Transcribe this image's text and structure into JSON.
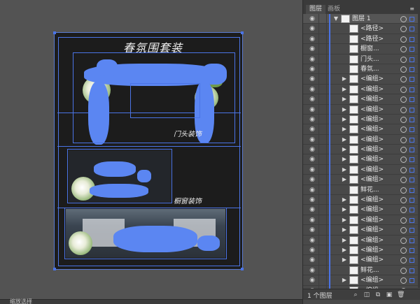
{
  "artboard": {
    "title": "春氛围套装",
    "labels": [
      "门头装饰",
      "橱窗装饰"
    ]
  },
  "status": {
    "text": "缩放选择"
  },
  "panel": {
    "tabs": [
      "图层",
      "画板"
    ],
    "menu_glyph": "≡",
    "layer_count": "1 个图层",
    "rows": [
      {
        "name": "图层 1",
        "type": "layer",
        "expand": "▼",
        "thumb": true
      },
      {
        "name": "<路径>",
        "type": "item",
        "expand": "",
        "thumb": true
      },
      {
        "name": "<路径>",
        "type": "item",
        "expand": "",
        "thumb": true
      },
      {
        "name": "橱窗...",
        "type": "item",
        "expand": "",
        "thumb": true
      },
      {
        "name": "门头...",
        "type": "item",
        "expand": "",
        "thumb": true
      },
      {
        "name": "春氛...",
        "type": "item",
        "expand": "",
        "thumb": true
      },
      {
        "name": "<编组>",
        "type": "item",
        "expand": "▶",
        "thumb": true
      },
      {
        "name": "<编组>",
        "type": "item",
        "expand": "▶",
        "thumb": true
      },
      {
        "name": "<编组>",
        "type": "item",
        "expand": "▶",
        "thumb": true
      },
      {
        "name": "<编组>",
        "type": "item",
        "expand": "▶",
        "thumb": true
      },
      {
        "name": "<编组>",
        "type": "item",
        "expand": "▶",
        "thumb": true
      },
      {
        "name": "<编组>",
        "type": "item",
        "expand": "▶",
        "thumb": true
      },
      {
        "name": "<编组>",
        "type": "item",
        "expand": "▶",
        "thumb": true
      },
      {
        "name": "<编组>",
        "type": "item",
        "expand": "▶",
        "thumb": true
      },
      {
        "name": "<编组>",
        "type": "item",
        "expand": "▶",
        "thumb": true
      },
      {
        "name": "<编组>",
        "type": "item",
        "expand": "▶",
        "thumb": true
      },
      {
        "name": "<编组>",
        "type": "item",
        "expand": "▶",
        "thumb": true
      },
      {
        "name": "鲜花...",
        "type": "item",
        "expand": "",
        "thumb": true
      },
      {
        "name": "<编组>",
        "type": "item",
        "expand": "▶",
        "thumb": true
      },
      {
        "name": "<编组>",
        "type": "item",
        "expand": "▶",
        "thumb": true
      },
      {
        "name": "<编组>",
        "type": "item",
        "expand": "▶",
        "thumb": true
      },
      {
        "name": "<编组>",
        "type": "item",
        "expand": "▶",
        "thumb": true
      },
      {
        "name": "<编组>",
        "type": "item",
        "expand": "▶",
        "thumb": true
      },
      {
        "name": "<编组>",
        "type": "item",
        "expand": "▶",
        "thumb": true
      },
      {
        "name": "<编组>",
        "type": "item",
        "expand": "▶",
        "thumb": true
      },
      {
        "name": "鲜花...",
        "type": "item",
        "expand": "",
        "thumb": true
      },
      {
        "name": "<编组>",
        "type": "item",
        "expand": "▶",
        "thumb": true
      },
      {
        "name": "<编组>",
        "type": "item",
        "expand": "▶",
        "thumb": true
      }
    ]
  },
  "colors": {
    "selection": "#4b74e6",
    "panel_bg": "#494949",
    "workspace_bg": "#535353",
    "artboard_bg": "#1c1c1c"
  }
}
